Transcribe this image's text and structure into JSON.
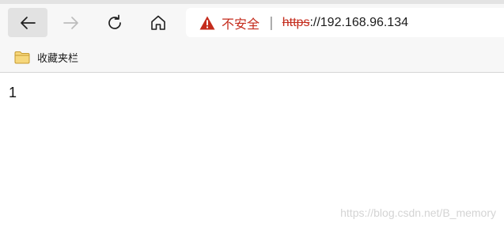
{
  "browser": {
    "address_bar": {
      "security_warning": "不安全",
      "separator": "|",
      "scheme": "https",
      "scheme_separator": "://",
      "host": "192.168.96.134"
    },
    "favorites_bar": {
      "items": [
        {
          "label": "收藏夹栏",
          "icon": "folder-icon"
        }
      ]
    },
    "icons": {
      "back": "arrow-left-icon",
      "forward": "arrow-right-icon",
      "reload": "reload-icon",
      "home": "home-icon",
      "warning": "warning-triangle-icon"
    },
    "colors": {
      "warning": "#c42b1c",
      "toolbar_bg": "#f7f7f7",
      "back_hover": "#e2e2e2"
    }
  },
  "page": {
    "body_text": "1",
    "watermark": "https://blog.csdn.net/B_memory"
  }
}
